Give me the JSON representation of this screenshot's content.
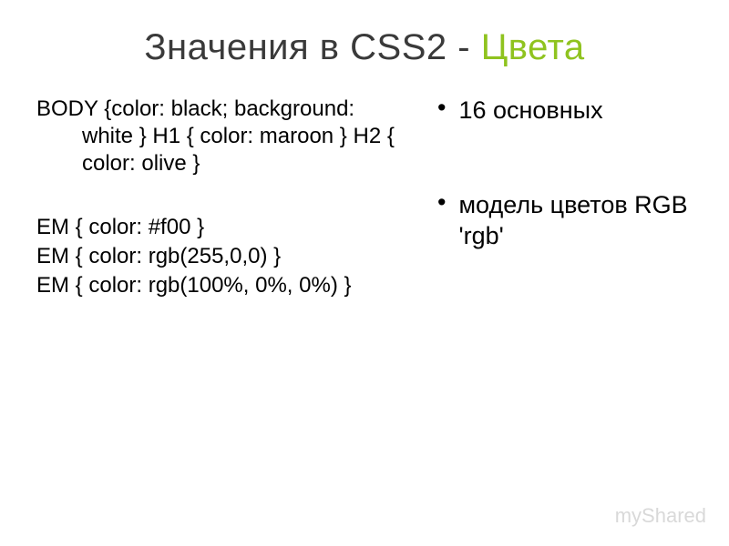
{
  "title": {
    "part1": "Значения в CSS2 - ",
    "part2": "Цвета"
  },
  "left": {
    "block1": "BODY {color: black; background: white } H1 { color: maroon } H2 { color: olive }",
    "line1": "EM { color: #f00 }",
    "line2": "EM { color: rgb(255,0,0) }",
    "line3": "EM { color: rgb(100%, 0%, 0%) }"
  },
  "right": {
    "bullets": [
      "16 основных",
      "модель цветов RGB 'rgb'"
    ]
  },
  "watermark": "myShared"
}
